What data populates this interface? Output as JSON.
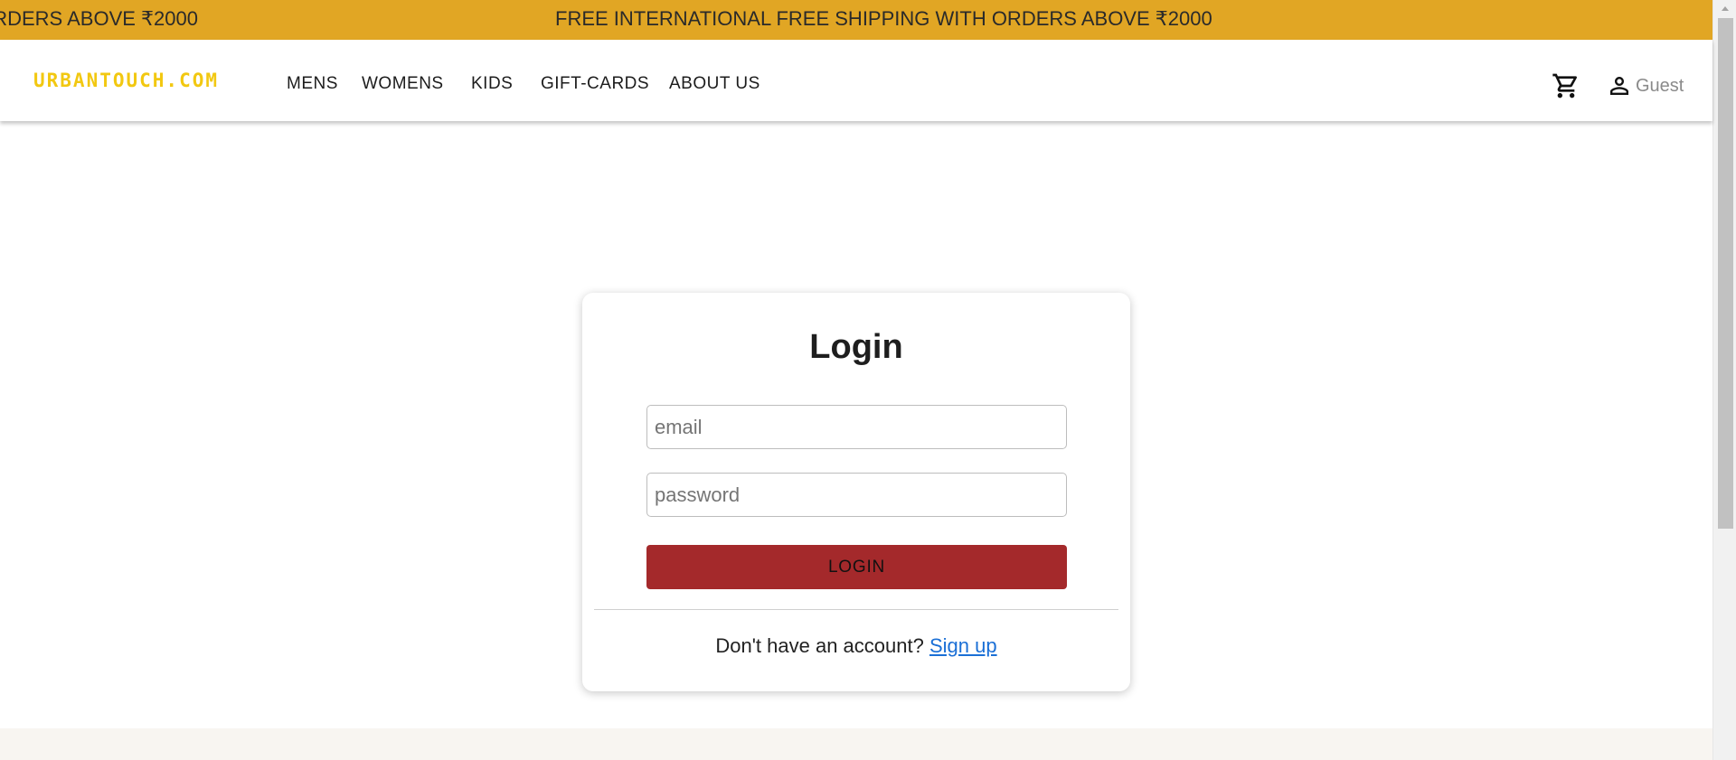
{
  "banner": {
    "text_partial": "RDERS ABOVE ₹2000",
    "text_full": "FREE INTERNATIONAL FREE SHIPPING WITH ORDERS ABOVE ₹2000",
    "background": "#e1a624"
  },
  "header": {
    "logo": "URBANTOUCH.COM",
    "logo_color": "#f2c811",
    "nav": [
      {
        "label": "MENS"
      },
      {
        "label": "WOMENS"
      },
      {
        "label": "KIDS"
      },
      {
        "label": "GIFT-CARDS"
      },
      {
        "label": "ABOUT US"
      }
    ],
    "cart_icon": "shopping-cart-icon",
    "user_icon": "user-icon",
    "user_name": "Guest"
  },
  "login": {
    "title": "Login",
    "email_placeholder": "email",
    "password_placeholder": "password",
    "submit_label": "LOGIN",
    "submit_color": "#a4292b",
    "signup_prompt": "Don't have an account?",
    "signup_link": "Sign up",
    "link_color": "#1a6fd6"
  }
}
